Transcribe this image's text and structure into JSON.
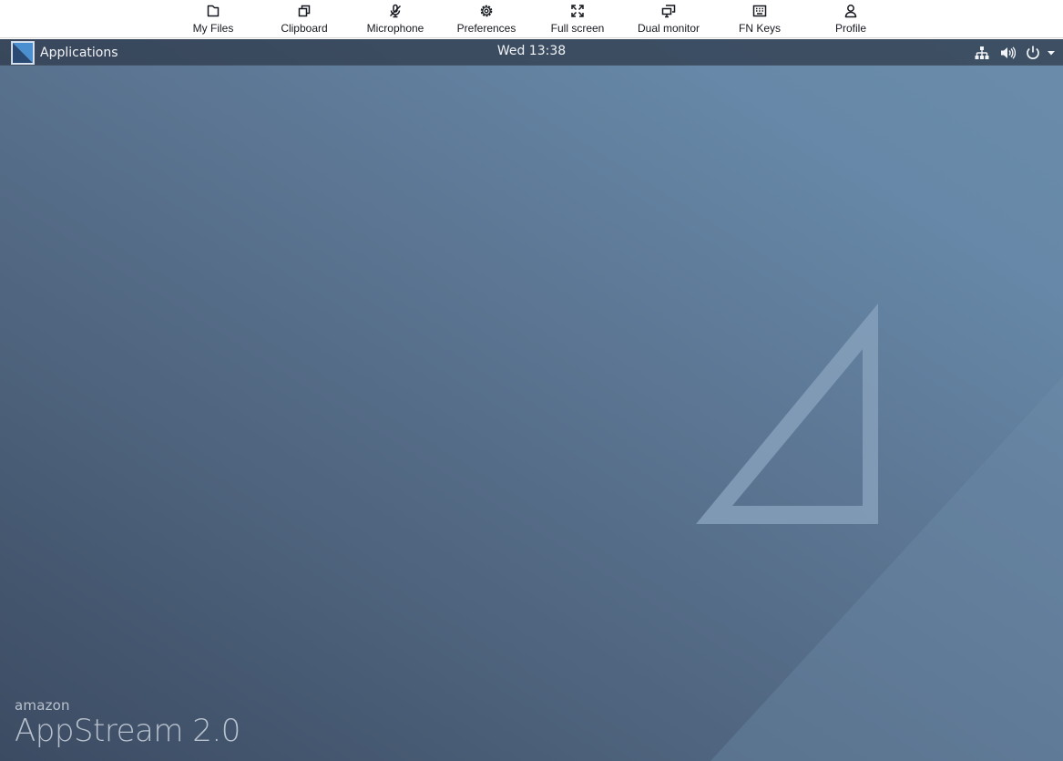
{
  "toolbar": {
    "items": [
      {
        "label": "My Files",
        "icon": "folder-icon"
      },
      {
        "label": "Clipboard",
        "icon": "clipboard-icon"
      },
      {
        "label": "Microphone",
        "icon": "microphone-muted-icon"
      },
      {
        "label": "Preferences",
        "icon": "gear-icon"
      },
      {
        "label": "Full screen",
        "icon": "fullscreen-icon"
      },
      {
        "label": "Dual monitor",
        "icon": "dual-monitor-icon"
      },
      {
        "label": "FN Keys",
        "icon": "keyboard-icon"
      },
      {
        "label": "Profile",
        "icon": "user-icon"
      }
    ]
  },
  "panel": {
    "app_menu_label": "Applications",
    "clock": "Wed 13:38",
    "tray_icons": [
      "network-icon",
      "volume-icon",
      "power-icon",
      "caret-down-icon"
    ]
  },
  "branding": {
    "line1": "amazon",
    "line2": "AppStream 2.0"
  }
}
